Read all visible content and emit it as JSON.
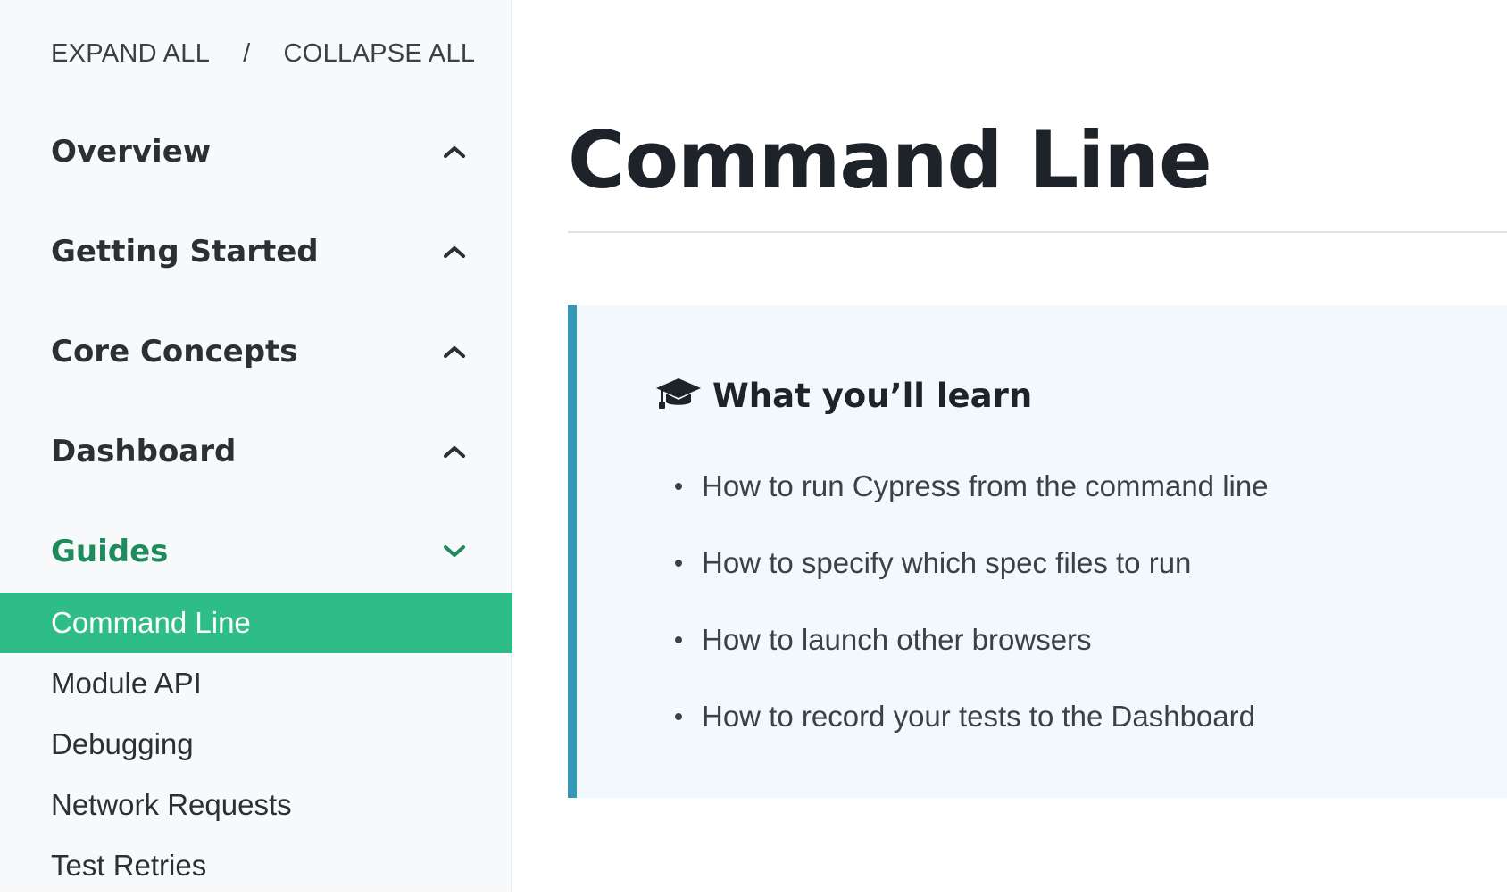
{
  "sidebar": {
    "expand_all": "EXPAND ALL",
    "separator": "/",
    "collapse_all": "COLLAPSE ALL",
    "sections": [
      {
        "label": "Overview",
        "state": "collapsed",
        "icon": "chevron-up-icon"
      },
      {
        "label": "Getting Started",
        "state": "collapsed",
        "icon": "chevron-up-icon"
      },
      {
        "label": "Core Concepts",
        "state": "collapsed",
        "icon": "chevron-up-icon"
      },
      {
        "label": "Dashboard",
        "state": "collapsed",
        "icon": "chevron-up-icon"
      },
      {
        "label": "Guides",
        "state": "expanded",
        "icon": "chevron-down-icon"
      }
    ],
    "guides_items": [
      {
        "label": "Command Line",
        "selected": true
      },
      {
        "label": "Module API",
        "selected": false
      },
      {
        "label": "Debugging",
        "selected": false
      },
      {
        "label": "Network Requests",
        "selected": false
      },
      {
        "label": "Test Retries",
        "selected": false
      }
    ]
  },
  "main": {
    "title": "Command Line",
    "callout": {
      "icon": "graduation-cap-icon",
      "heading": "What you’ll learn",
      "items": [
        "How to run Cypress from the command line",
        "How to specify which spec files to run",
        "How to launch other browsers",
        "How to record your tests to the Dashboard"
      ]
    }
  },
  "colors": {
    "accent_green": "#2ebd88",
    "active_section_text": "#1f8b5c",
    "callout_border": "#3498b8",
    "callout_bg": "#f2f8fb",
    "sidebar_bg": "#f7f9fa"
  }
}
